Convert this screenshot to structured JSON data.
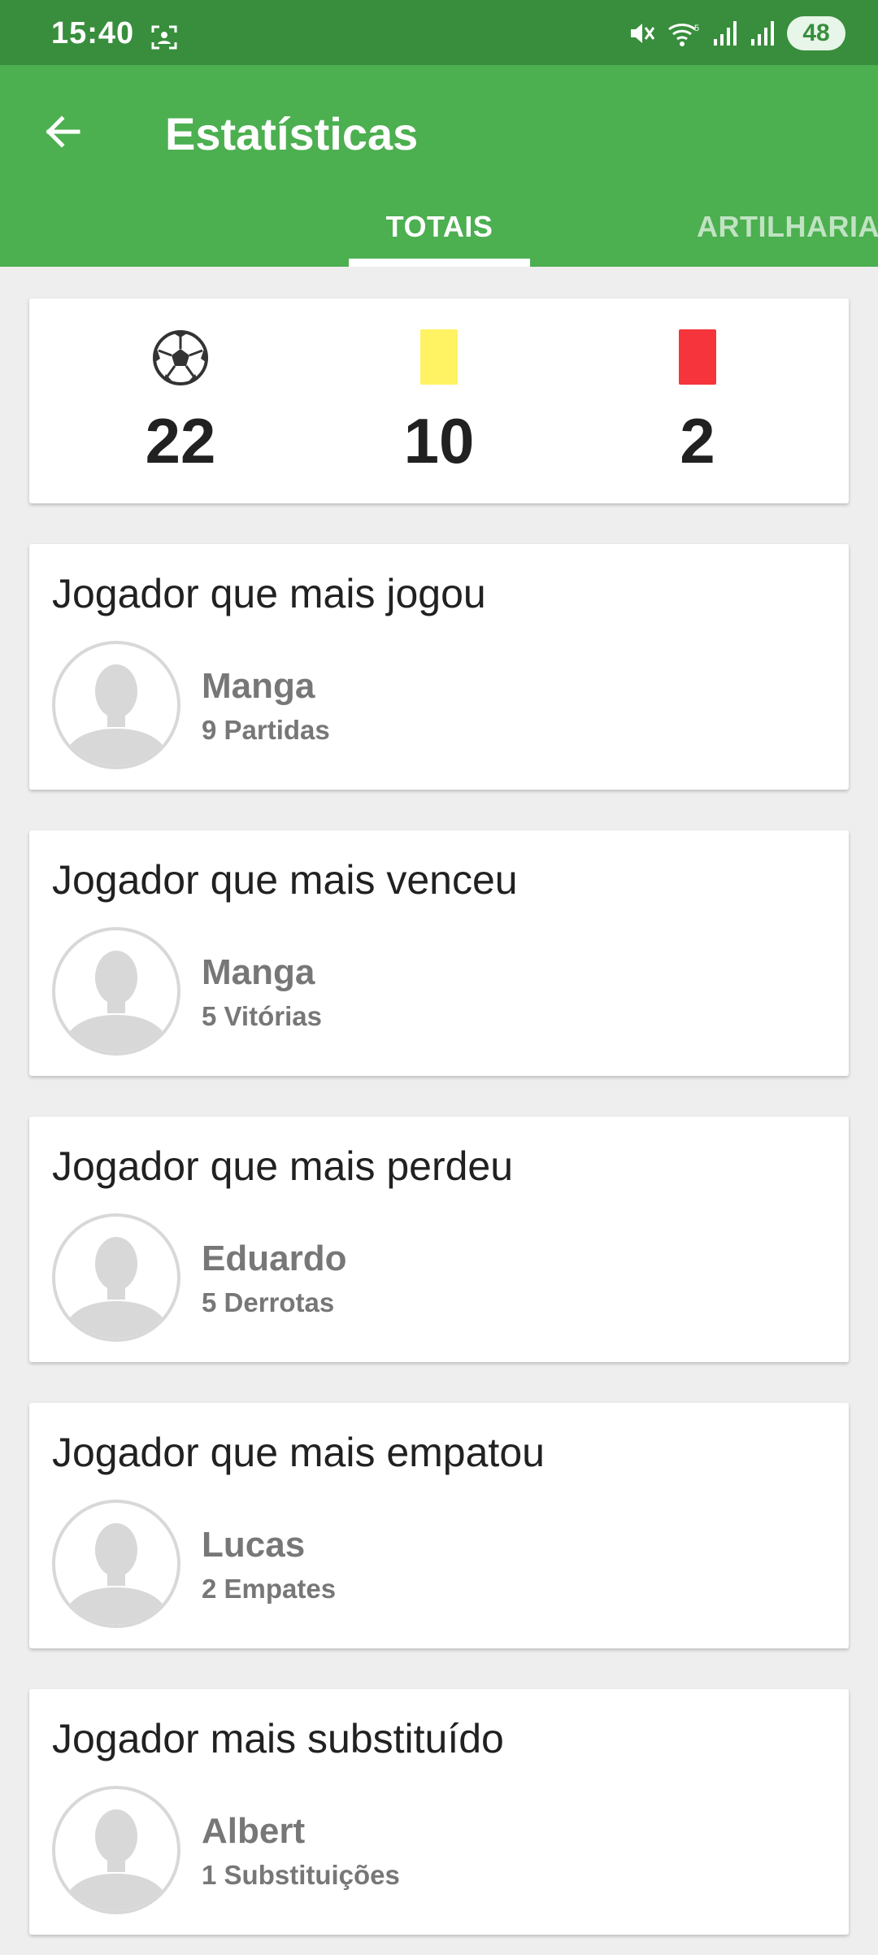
{
  "status_bar": {
    "time": "15:40",
    "battery": "48",
    "icons": [
      "screenshot-icon",
      "mute-icon",
      "wifi-icon",
      "signal-icon",
      "signal-icon"
    ]
  },
  "app_bar": {
    "title": "Estatísticas",
    "back_icon": "arrow-left-icon",
    "tabs": [
      {
        "label": "TOTAIS",
        "selected": true
      },
      {
        "label": "ARTILHARIA",
        "selected": false
      }
    ]
  },
  "totals": {
    "goals": {
      "icon": "soccer-ball-icon",
      "value": "22"
    },
    "yellow_cards": {
      "icon": "yellow-card-icon",
      "value": "10"
    },
    "red_cards": {
      "icon": "red-card-icon",
      "value": "2"
    }
  },
  "player_cards": [
    {
      "title": "Jogador que mais jogou",
      "name": "Manga",
      "stat": "9 Partidas"
    },
    {
      "title": "Jogador que mais venceu",
      "name": "Manga",
      "stat": "5 Vitórias"
    },
    {
      "title": "Jogador que mais perdeu",
      "name": "Eduardo",
      "stat": "5 Derrotas"
    },
    {
      "title": "Jogador que mais empatou",
      "name": "Lucas",
      "stat": "2 Empates"
    },
    {
      "title": "Jogador mais substituído",
      "name": "Albert",
      "stat": "1 Substituições"
    }
  ],
  "colors": {
    "status_bar": "#388e3c",
    "app_bar": "#4caf50",
    "background": "#eeeeee",
    "yellow_card": "#fff263",
    "red_card": "#f5343b"
  }
}
